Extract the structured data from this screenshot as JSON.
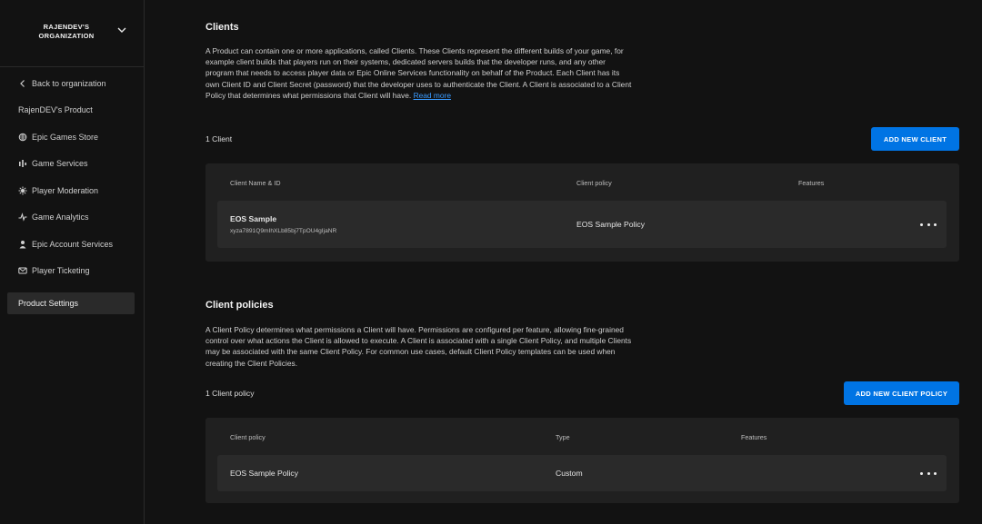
{
  "org": {
    "name": "RAJENDEV'S ORGANIZATION"
  },
  "sidebar": {
    "items": [
      {
        "label": "Back to organization",
        "icon": "chevron-left-icon"
      },
      {
        "label": "RajenDEV's Product",
        "icon": ""
      },
      {
        "label": "Epic Games Store",
        "icon": "store-icon"
      },
      {
        "label": "Game Services",
        "icon": "services-icon"
      },
      {
        "label": "Player Moderation",
        "icon": "moderation-icon"
      },
      {
        "label": "Game Analytics",
        "icon": "analytics-icon"
      },
      {
        "label": "Epic Account Services",
        "icon": "account-icon"
      },
      {
        "label": "Player Ticketing",
        "icon": "ticket-icon"
      },
      {
        "label": "Product Settings",
        "icon": ""
      }
    ]
  },
  "clients": {
    "title": "Clients",
    "description": "A Product can contain one or more applications, called Clients. These Clients represent the different builds of your game, for example client builds that players run on their systems, dedicated servers builds that the developer runs, and any other program that needs to access player data or Epic Online Services functionality on behalf of the Product. Each Client has its own Client ID and Client Secret (password) that the developer uses to authenticate the Client. A Client is associated to a Client Policy that determines what permissions that Client will have.",
    "read_more": "Read more",
    "count": "1 Client",
    "add_button": "ADD NEW CLIENT",
    "columns": [
      "Client Name & ID",
      "Client policy",
      "Features"
    ],
    "rows": [
      {
        "name": "EOS Sample",
        "id": "xyza7891Q9mIhXLb85bj7TpOU4gIjaNR",
        "policy": "EOS Sample Policy"
      }
    ]
  },
  "policies": {
    "title": "Client policies",
    "description": "A Client Policy determines what permissions a Client will have. Permissions are configured per feature, allowing fine-grained control over what actions the Client is allowed to execute. A Client is associated with a single Client Policy, and multiple Clients may be associated with the same Client Policy. For common use cases, default Client Policy templates can be used when creating the Client Policies.",
    "count": "1 Client policy",
    "add_button": "ADD NEW CLIENT POLICY",
    "columns": [
      "Client policy",
      "Type",
      "Features"
    ],
    "rows": [
      {
        "name": "EOS Sample Policy",
        "type": "Custom"
      }
    ]
  },
  "colors": {
    "accent": "#0074e4",
    "background": "#121212",
    "panel": "#202020",
    "row": "#2a2a2a",
    "link": "#3a9bff"
  }
}
